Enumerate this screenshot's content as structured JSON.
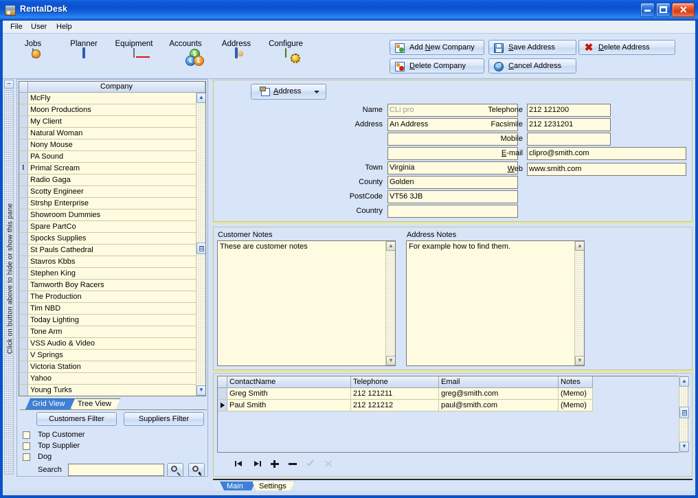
{
  "window": {
    "title": "RentalDesk",
    "app_icon": "app-icon",
    "minimize": "minimize-icon",
    "maximize": "maximize-icon",
    "close": "close-icon"
  },
  "menu": {
    "items": [
      {
        "label": "File"
      },
      {
        "label": "User"
      },
      {
        "label": "Help"
      }
    ]
  },
  "toolbar": {
    "buttons": [
      {
        "label": "Jobs",
        "icon": "jobs-icon"
      },
      {
        "label": "Planner",
        "icon": "planner-icon"
      },
      {
        "label": "Equipment",
        "icon": "equipment-icon"
      },
      {
        "label": "Accounts",
        "icon": "accounts-icon"
      },
      {
        "label": "Address",
        "icon": "address-icon"
      },
      {
        "label": "Configure",
        "icon": "configure-icon"
      }
    ],
    "actions": [
      {
        "id": "add-new-company",
        "pre": "Add ",
        "accel": "N",
        "post": "ew Company",
        "icon": "add-company-icon"
      },
      {
        "id": "save-address",
        "pre": "",
        "accel": "S",
        "post": "ave Address",
        "icon": "save-icon"
      },
      {
        "id": "delete-address",
        "pre": "",
        "accel": "D",
        "post": "elete Address",
        "icon": "delete-icon"
      },
      {
        "id": "delete-company",
        "pre": "",
        "accel": "D",
        "post": "elete Company",
        "icon": "delete-company-icon"
      },
      {
        "id": "cancel-address",
        "pre": "",
        "accel": "C",
        "post": "ancel Address",
        "icon": "cancel-icon"
      }
    ]
  },
  "left_pane": {
    "splitter_hint": "Click on button above to hide or show this pane",
    "collapse_button": "–",
    "grid": {
      "column_header": "Company",
      "current_row_index": 6,
      "rows": [
        "McFly",
        "Moon Productions",
        "My Client",
        "Natural Woman",
        "Nony Mouse",
        "PA Sound",
        "Primal Scream",
        "Radio Gaga",
        "Scotty Engineer",
        "Strshp Enterprise",
        "Showroom Dummies",
        "Spare PartCo",
        "Spocks Supplies",
        "St Pauls Cathedral",
        "Stavros Kbbs",
        "Stephen King",
        "Tamworth Boy Racers",
        "The Production",
        "Tim NBD",
        "Today Lighting",
        "Tone Arm",
        "VSS Audio & Video",
        "V Springs",
        "Victoria Station",
        "Yahoo",
        "Young Turks"
      ]
    },
    "tabs": [
      {
        "label": "Grid View",
        "selected": true
      },
      {
        "label": "Tree View",
        "selected": false
      }
    ],
    "filters": {
      "customers_button": "Customers Filter",
      "suppliers_button": "Suppliers Filter",
      "checkboxes": [
        {
          "label": "Top Customer",
          "checked": false
        },
        {
          "label": "Top Supplier",
          "checked": false
        },
        {
          "label": "Dog",
          "checked": false
        }
      ],
      "search_label": "Search",
      "search_value": "",
      "search_button": "search-icon",
      "search_add_button": "search-add-icon"
    }
  },
  "address_panel": {
    "dropdown": {
      "pre": "",
      "accel": "A",
      "post": "ddress",
      "icon": "address-record-icon"
    },
    "left_fields": [
      {
        "label": "Name",
        "value": "CLi pro",
        "dim": true
      },
      {
        "label": "Address",
        "value": "An Address",
        "dim": false
      },
      {
        "label": "",
        "value": "",
        "dim": false
      },
      {
        "label": "",
        "value": "",
        "dim": false
      },
      {
        "label": "Town",
        "value": "Virginia",
        "dim": false
      },
      {
        "label": "County",
        "value": "Golden",
        "dim": false
      },
      {
        "label": "PostCode",
        "value": "VT56 3JB",
        "dim": false
      },
      {
        "label": "Country",
        "value": "",
        "dim": false
      }
    ],
    "right_fields": [
      {
        "label": "Telephone",
        "value": "212 121200",
        "link": false
      },
      {
        "label": "Facsimile",
        "value": "212 1231201",
        "link": false
      },
      {
        "label": "Mobile",
        "value": "",
        "link": false
      },
      {
        "label": "E-mail",
        "value": "clipro@smith.com",
        "link": true,
        "accel": "E",
        "pre": "",
        "post": "-mail"
      },
      {
        "label": "Web",
        "value": "www.smith.com",
        "link": true,
        "accel": "W",
        "pre": "",
        "post": "eb"
      }
    ]
  },
  "notes_panel": {
    "customer_notes_title": "Customer Notes",
    "customer_notes_value": "These are customer notes",
    "address_notes_title": "Address Notes",
    "address_notes_value": "For example how to find them."
  },
  "contacts": {
    "columns": [
      "ContactName",
      "Telephone",
      "Email",
      "Notes"
    ],
    "rows": [
      {
        "ContactName": "Greg Smith",
        "Telephone": "212 121211",
        "Email": "greg@smith.com",
        "Notes": "(Memo)",
        "current": false
      },
      {
        "ContactName": "Paul Smith",
        "Telephone": "212 121212",
        "Email": "paul@smith.com",
        "Notes": "(Memo)",
        "current": true
      }
    ],
    "navigator": [
      {
        "name": "first-record-button",
        "icon": "first-icon",
        "disabled": false
      },
      {
        "name": "last-record-button",
        "icon": "last-icon",
        "disabled": false
      },
      {
        "name": "insert-record-button",
        "icon": "plus-icon",
        "disabled": false
      },
      {
        "name": "delete-record-button",
        "icon": "minus-icon",
        "disabled": false
      },
      {
        "name": "post-edit-button",
        "icon": "check-icon",
        "disabled": true
      },
      {
        "name": "cancel-edit-button",
        "icon": "x-icon",
        "disabled": true
      }
    ]
  },
  "bottom_tabs": [
    {
      "label": "Main",
      "selected": true
    },
    {
      "label": "Settings",
      "selected": false
    }
  ],
  "colors": {
    "title_blue": "#0a52c8",
    "panel_blue": "#d8e4f8",
    "field_cream": "#fffbe0",
    "panel_border_olive": "#c8c88a",
    "tab_selected": "#3d80d8"
  }
}
